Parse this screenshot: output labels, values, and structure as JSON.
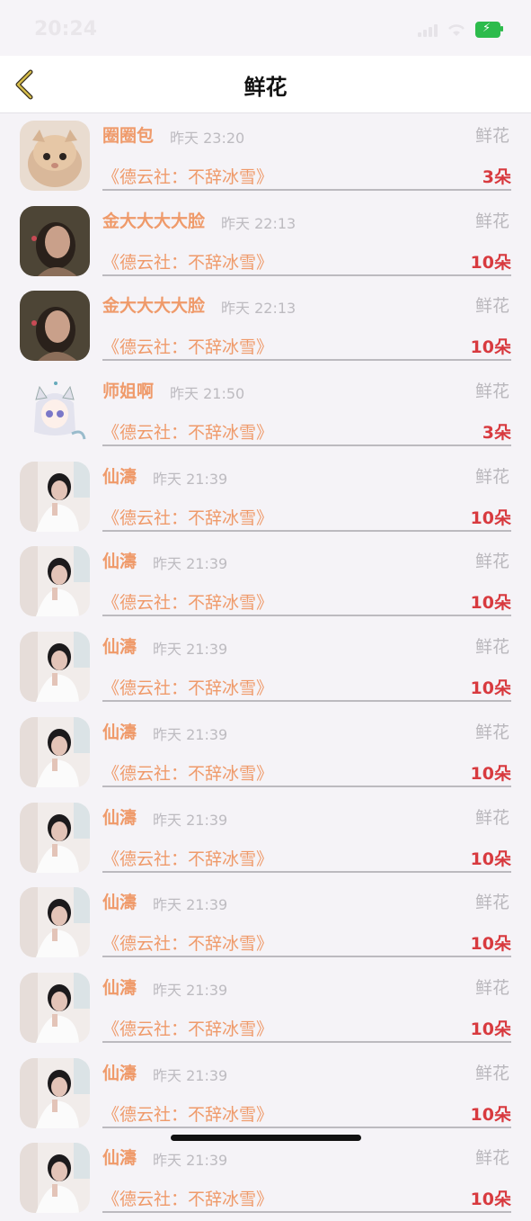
{
  "status_bar": {
    "time": "20:24"
  },
  "nav": {
    "title": "鲜花"
  },
  "items": [
    {
      "name": "圈圈包",
      "time": "昨天 23:20",
      "gift": "鲜花",
      "program": "《德云社：不辞冰雪》",
      "count": "3朵",
      "avatar": "kitten"
    },
    {
      "name": "金大大大大脸",
      "time": "昨天 22:13",
      "gift": "鲜花",
      "program": "《德云社：不辞冰雪》",
      "count": "10朵",
      "avatar": "girl-dark"
    },
    {
      "name": "金大大大大脸",
      "time": "昨天 22:13",
      "gift": "鲜花",
      "program": "《德云社：不辞冰雪》",
      "count": "10朵",
      "avatar": "girl-dark"
    },
    {
      "name": "师姐啊",
      "time": "昨天 21:50",
      "gift": "鲜花",
      "program": "《德云社：不辞冰雪》",
      "count": "3朵",
      "avatar": "anime"
    },
    {
      "name": "仙濤",
      "time": "昨天 21:39",
      "gift": "鲜花",
      "program": "《德云社：不辞冰雪》",
      "count": "10朵",
      "avatar": "girl-white"
    },
    {
      "name": "仙濤",
      "time": "昨天 21:39",
      "gift": "鲜花",
      "program": "《德云社：不辞冰雪》",
      "count": "10朵",
      "avatar": "girl-white"
    },
    {
      "name": "仙濤",
      "time": "昨天 21:39",
      "gift": "鲜花",
      "program": "《德云社：不辞冰雪》",
      "count": "10朵",
      "avatar": "girl-white"
    },
    {
      "name": "仙濤",
      "time": "昨天 21:39",
      "gift": "鲜花",
      "program": "《德云社：不辞冰雪》",
      "count": "10朵",
      "avatar": "girl-white"
    },
    {
      "name": "仙濤",
      "time": "昨天 21:39",
      "gift": "鲜花",
      "program": "《德云社：不辞冰雪》",
      "count": "10朵",
      "avatar": "girl-white"
    },
    {
      "name": "仙濤",
      "time": "昨天 21:39",
      "gift": "鲜花",
      "program": "《德云社：不辞冰雪》",
      "count": "10朵",
      "avatar": "girl-white"
    },
    {
      "name": "仙濤",
      "time": "昨天 21:39",
      "gift": "鲜花",
      "program": "《德云社：不辞冰雪》",
      "count": "10朵",
      "avatar": "girl-white"
    },
    {
      "name": "仙濤",
      "time": "昨天 21:39",
      "gift": "鲜花",
      "program": "《德云社：不辞冰雪》",
      "count": "10朵",
      "avatar": "girl-white"
    },
    {
      "name": "仙濤",
      "time": "昨天 21:39",
      "gift": "鲜花",
      "program": "《德云社：不辞冰雪》",
      "count": "10朵",
      "avatar": "girl-white"
    }
  ]
}
